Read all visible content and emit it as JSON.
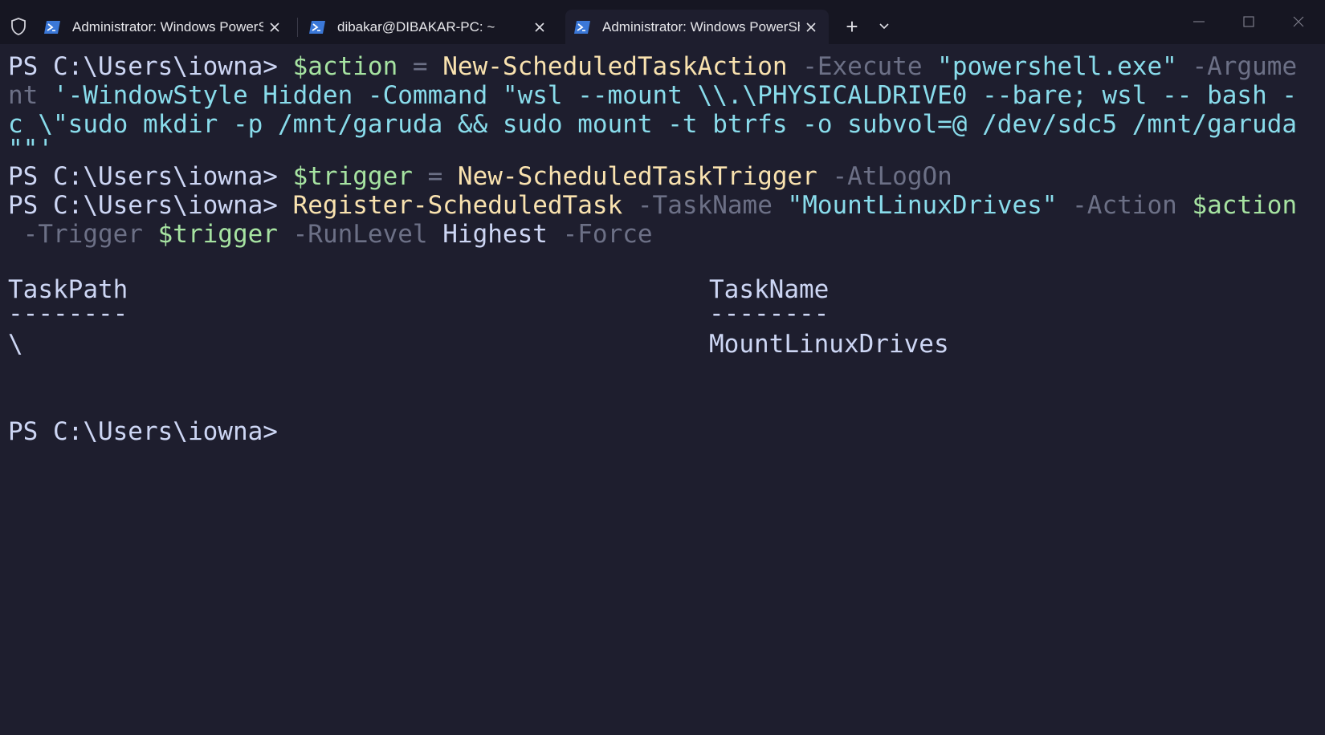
{
  "window": {
    "tabs": [
      {
        "title": "Administrator: Windows PowerShell",
        "icon": "powershell-icon",
        "active": false
      },
      {
        "title": "dibakar@DIBAKAR-PC: ~",
        "icon": "powershell-icon",
        "active": false
      },
      {
        "title": "Administrator: Windows PowerShell",
        "icon": "powershell-icon",
        "active": true
      }
    ],
    "new_tab_label": "+",
    "colors": {
      "titlebar": "#161622",
      "background": "#1e1e2e",
      "accent_icon": "#3b78d8"
    }
  },
  "terminal": {
    "line1": {
      "prompt": "PS C:\\Users\\iowna> ",
      "var": "$action",
      "op": " = ",
      "cmd": "New-ScheduledTaskAction",
      "param1": " -Execute ",
      "str1": "\"powershell.exe\"",
      "param2": " -Argume"
    },
    "line2": {
      "param": "nt",
      "str": " '-WindowStyle Hidden -Command \"wsl --mount \\\\.\\PHYSICALDRIVE0 --bare; wsl -- bash -"
    },
    "line3": {
      "str": "c \\\"sudo mkdir -p /mnt/garuda && sudo mount -t btrfs -o subvol=@ /dev/sdc5 /mnt/garuda"
    },
    "line4": {
      "str": "\"\"'"
    },
    "line5": {
      "prompt": "PS C:\\Users\\iowna> ",
      "var": "$trigger",
      "op": " = ",
      "cmd": "New-ScheduledTaskTrigger",
      "param": " -AtLogOn"
    },
    "line6": {
      "prompt": "PS C:\\Users\\iowna> ",
      "cmd": "Register-ScheduledTask",
      "param1": " -TaskName ",
      "str": "\"MountLinuxDrives\"",
      "param2": " -Action ",
      "var": "$action"
    },
    "line7": {
      "param1": " -Trigger ",
      "var": "$trigger",
      "param2": " -RunLevel ",
      "plain": "Highest",
      "param3": " -Force"
    },
    "table": {
      "col1_header": "TaskPath",
      "col2_header": "TaskName",
      "col1_rule": "--------",
      "col2_rule": "--------",
      "col1_value": "\\",
      "col2_value": "MountLinuxDrives"
    },
    "final_prompt": "PS C:\\Users\\iowna>"
  }
}
